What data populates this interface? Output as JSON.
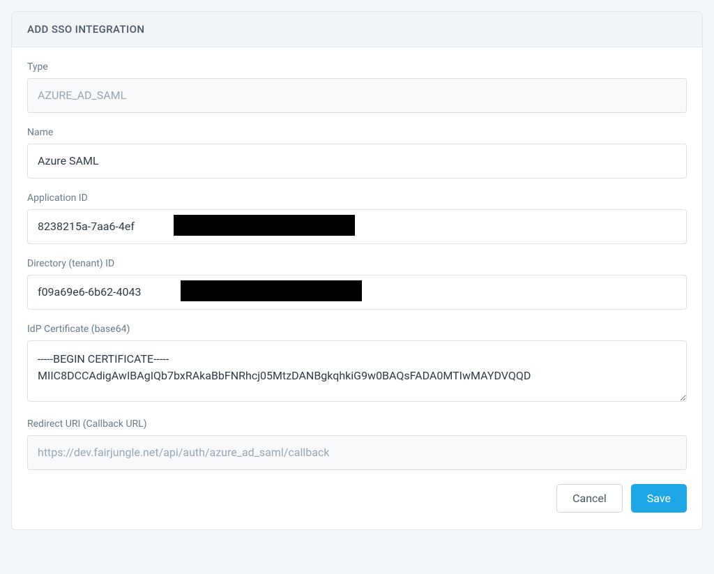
{
  "header": {
    "title": "ADD SSO INTEGRATION"
  },
  "fields": {
    "type": {
      "label": "Type",
      "value": "AZURE_AD_SAML"
    },
    "name": {
      "label": "Name",
      "value": "Azure SAML"
    },
    "application_id": {
      "label": "Application ID",
      "value": "8238215a-7aa6-4ef                                             "
    },
    "tenant_id": {
      "label": "Directory (tenant) ID",
      "value": "f09a69e6-6b62-4043                                             "
    },
    "idp_certificate": {
      "label": "IdP Certificate (base64)",
      "value": "-----BEGIN CERTIFICATE-----\nMIIC8DCCAdigAwIBAgIQb7bxRAkaBbFNRhcj05MtzDANBgkqhkiG9w0BAQsFADA0MTIwMAYDVQQD"
    },
    "redirect_uri": {
      "label": "Redirect URI (Callback URL)",
      "value": "https://dev.fairjungle.net/api/auth/azure_ad_saml/callback"
    }
  },
  "actions": {
    "cancel": "Cancel",
    "save": "Save"
  }
}
